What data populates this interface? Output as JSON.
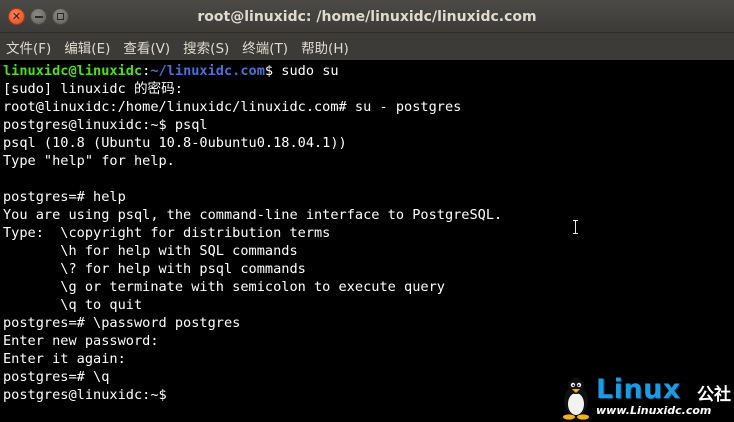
{
  "window": {
    "title": "root@linuxidc: /home/linuxidc/linuxidc.com",
    "close_glyph": "✕",
    "controls": [
      "close-icon",
      "minimize-icon",
      "maximize-icon"
    ]
  },
  "menu": {
    "items": [
      "文件(F)",
      "编辑(E)",
      "查看(V)",
      "搜索(S)",
      "终端(T)",
      "帮助(H)"
    ]
  },
  "terminal": {
    "colors": {
      "background": "#000000",
      "text": "#ffffff",
      "prompt_user": "#4be016",
      "prompt_path": "#4c6fd6"
    },
    "first_prompt": {
      "user": "linuxidc@linuxidc",
      "sep": ":",
      "path": "~/linuxidc.com",
      "rest": "$ sudo su"
    },
    "lines": [
      "[sudo] linuxidc 的密码:",
      "root@linuxidc:/home/linuxidc/linuxidc.com# su - postgres",
      "postgres@linuxidc:~$ psql",
      "psql (10.8 (Ubuntu 10.8-0ubuntu0.18.04.1))",
      "Type \"help\" for help.",
      "",
      "postgres=# help",
      "You are using psql, the command-line interface to PostgreSQL.",
      "Type:  \\copyright for distribution terms",
      "       \\h for help with SQL commands",
      "       \\? for help with psql commands",
      "       \\g or terminate with semicolon to execute query",
      "       \\q to quit",
      "postgres=# \\password postgres",
      "Enter new password:",
      "Enter it again:",
      "postgres=# \\q",
      "postgres@linuxidc:~$"
    ]
  },
  "watermark": {
    "brand": "Linux",
    "suffix": "公社",
    "url": "www.Linuxidc.com",
    "brand_color": "#1e9be0"
  }
}
